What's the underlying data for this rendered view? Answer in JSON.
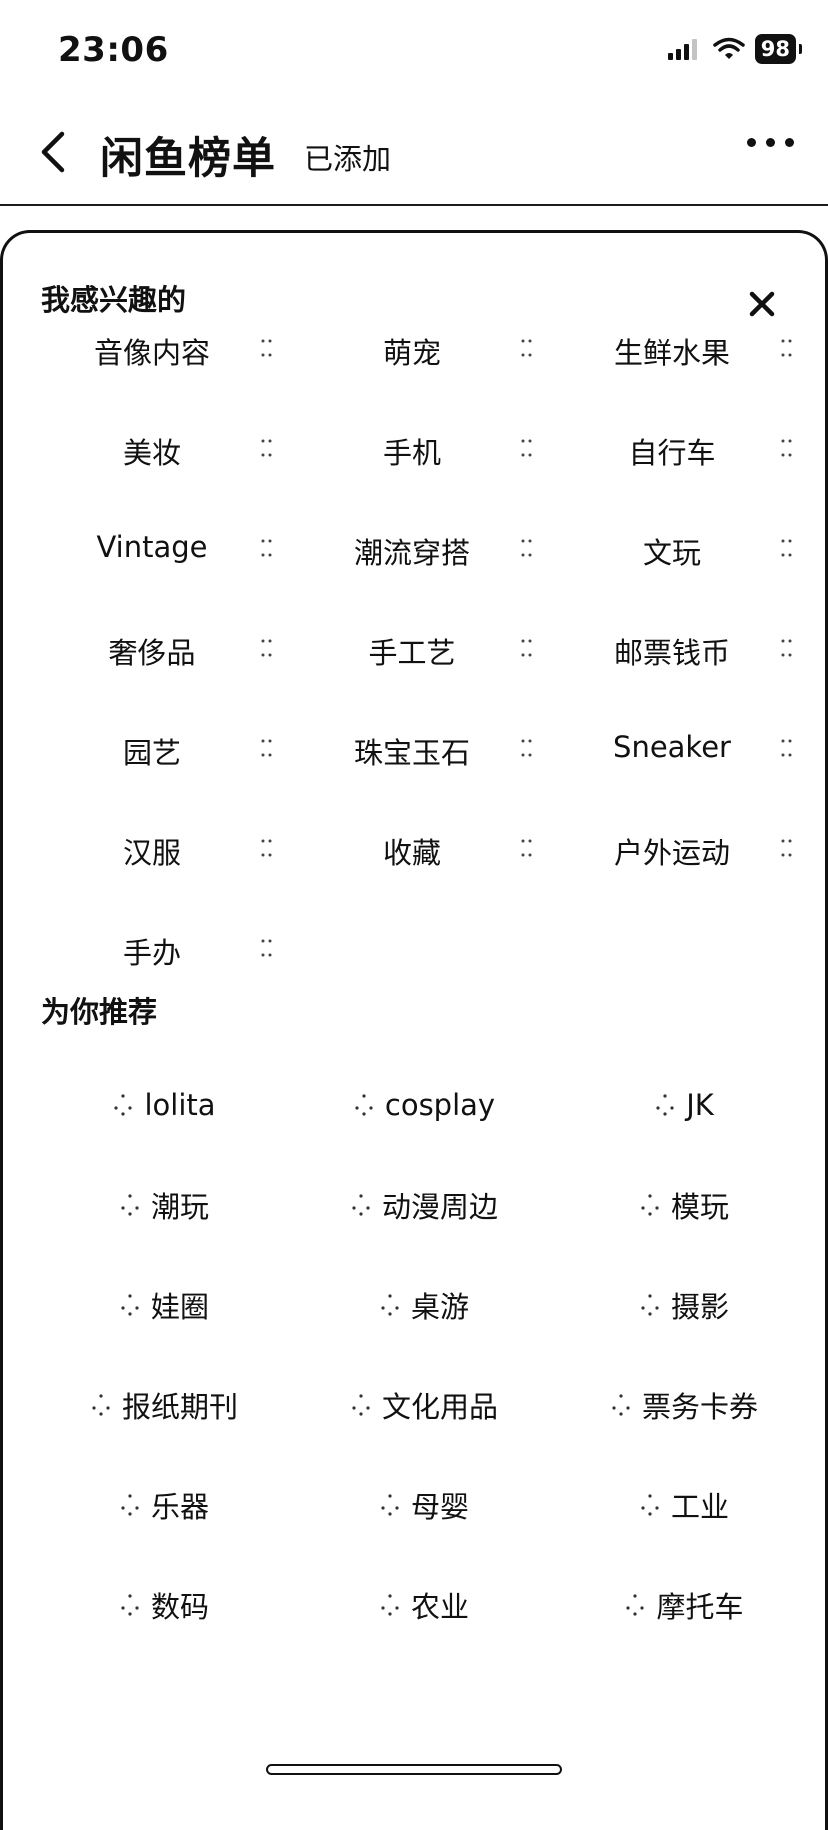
{
  "status_bar": {
    "time": "23:06",
    "battery": "98"
  },
  "nav": {
    "title": "闲鱼榜单",
    "subtitle": "已添加"
  },
  "interested": {
    "title": "我感兴趣的",
    "items": [
      "音像内容",
      "萌宠",
      "生鲜水果",
      "美妆",
      "手机",
      "自行车",
      "Vintage",
      "潮流穿搭",
      "文玩",
      "奢侈品",
      "手工艺",
      "邮票钱币",
      "园艺",
      "珠宝玉石",
      "Sneaker",
      "汉服",
      "收藏",
      "户外运动",
      "手办"
    ]
  },
  "recommended": {
    "title": "为你推荐",
    "items": [
      "lolita",
      "cosplay",
      "JK",
      "潮玩",
      "动漫周边",
      "模玩",
      "娃圈",
      "桌游",
      "摄影",
      "报纸期刊",
      "文化用品",
      "票务卡券",
      "乐器",
      "母婴",
      "工业",
      "数码",
      "农业",
      "摩托车"
    ]
  }
}
